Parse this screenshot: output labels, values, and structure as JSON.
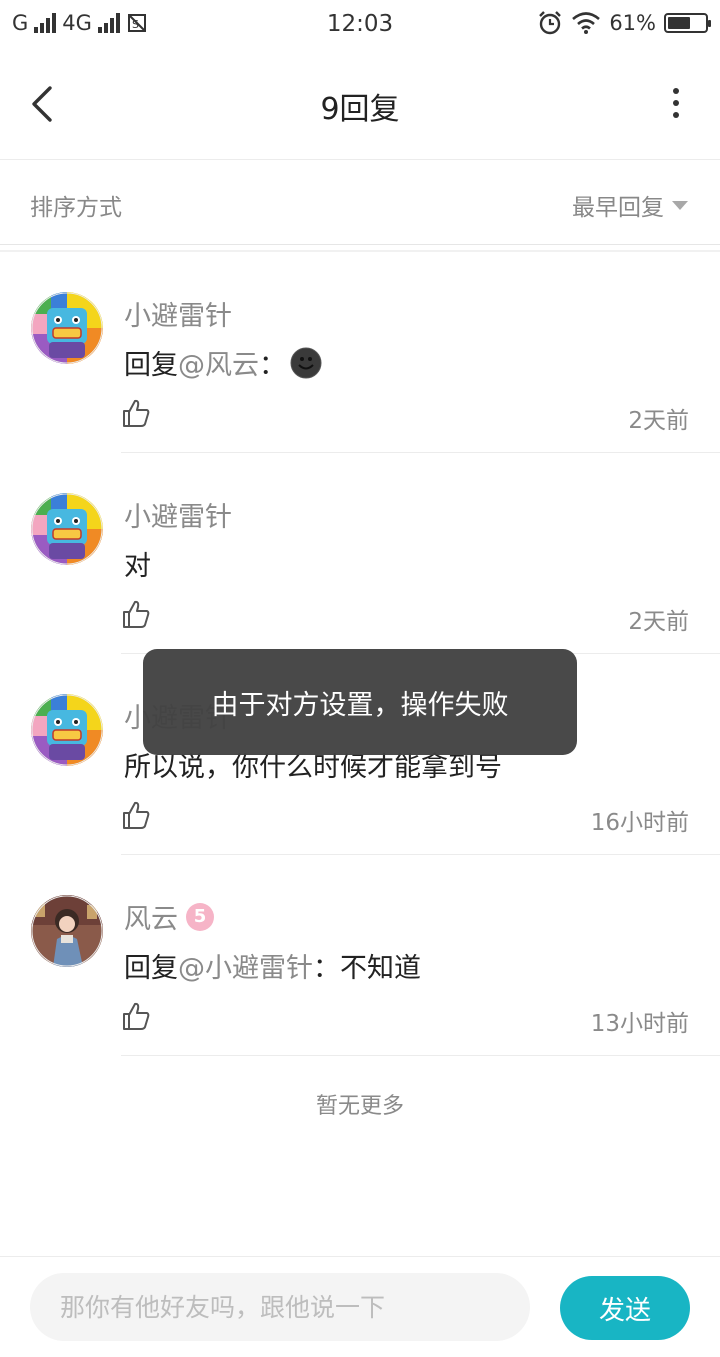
{
  "status_bar": {
    "carrier_left": "G",
    "network": "4G",
    "time": "12:03",
    "battery_text": "61%",
    "battery_level": 0.61,
    "icons": [
      "signal-icon",
      "signal-icon",
      "screenshot-notification-icon",
      "alarm-icon",
      "wifi-icon",
      "battery-icon"
    ]
  },
  "header": {
    "title": "9回复",
    "back_icon": "back-arrow-icon",
    "more_icon": "more-vertical-icon"
  },
  "sort": {
    "label": "排序方式",
    "selected": "最早回复",
    "caret_icon": "caret-down-icon"
  },
  "comments": [
    {
      "name": "小避雷针",
      "text_prefix": "回复",
      "mention": "@风云",
      "text_suffix": "：",
      "emoji": "smiley-face-icon",
      "time": "2天前",
      "like_icon": "thumbs-up-icon"
    },
    {
      "name": "小避雷针",
      "text": "对",
      "time": "2天前",
      "like_icon": "thumbs-up-icon"
    },
    {
      "name": "小避雷针",
      "text": "所以说，你什么时候才能拿到号",
      "time": "16小时前",
      "like_icon": "thumbs-up-icon"
    },
    {
      "name": "风云",
      "level": "5",
      "text_prefix": "回复",
      "mention": "@小避雷针",
      "text_suffix": "：不知道",
      "time": "13小时前",
      "like_icon": "thumbs-up-icon"
    }
  ],
  "footer_text": "暂无更多",
  "toast": "由于对方设置，操作失败",
  "input": {
    "placeholder": "那你有他好友吗，跟他说一下",
    "value": ""
  },
  "send_label": "发送",
  "colors": {
    "accent": "#18b5c4",
    "toast_bg": "#424242",
    "secondary_text": "#8a8a8a",
    "primary_text": "#222222"
  }
}
